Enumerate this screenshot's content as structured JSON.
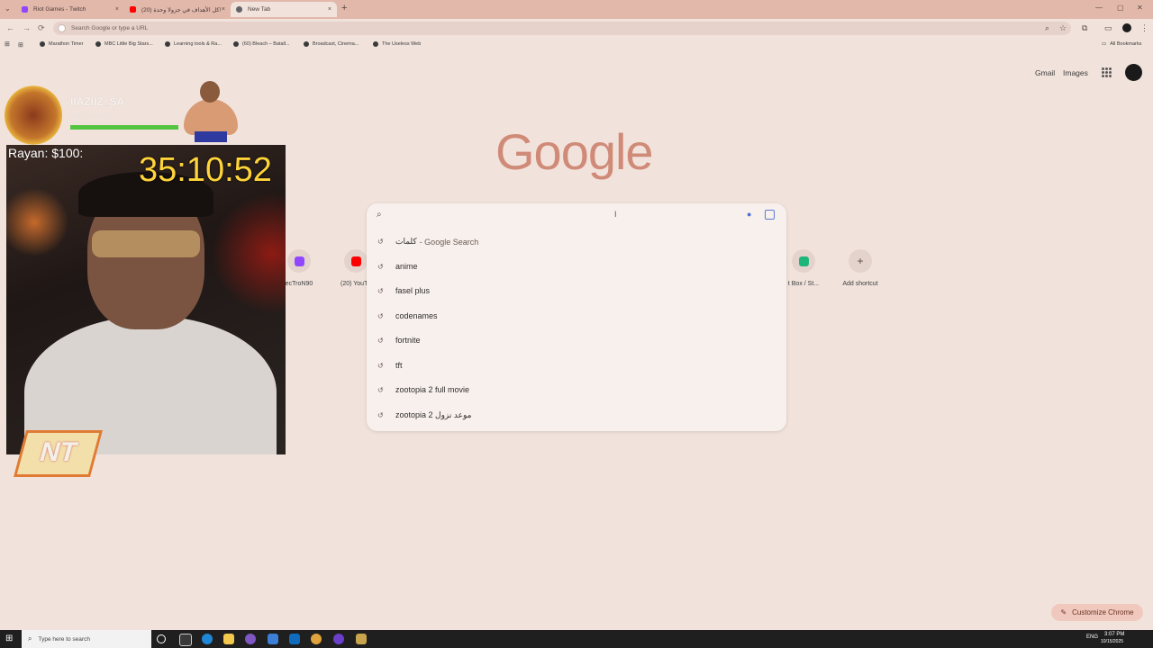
{
  "tabs": [
    {
      "label": "Riot Games - Twitch",
      "close": "×",
      "favicon_color": "#9147ff"
    },
    {
      "label": "(20) كل الأهداف في جزولا وحدة!",
      "close": "×",
      "favicon_color": "#ff0000"
    },
    {
      "label": "New Tab",
      "close": "×",
      "favicon_color": "#5f6368"
    }
  ],
  "tab_menu": "⌄",
  "new_tab": "+",
  "window_controls": {
    "minimize": "—",
    "maximize": "▢",
    "close": "✕"
  },
  "toolbar": {
    "back": "←",
    "forward": "→",
    "reload": "⟳",
    "omnibox_placeholder": "Search Google or type a URL",
    "zoom": "⌕",
    "star": "☆",
    "extensions": "⧉",
    "sidepanel": "▭",
    "menu": "⋮"
  },
  "bookmarks": {
    "apps": "⊞",
    "items": [
      "Marathon Timer",
      "MBC Little Big Stars...",
      "Learning tools & Ra...",
      "(60) Bleach – Batall...",
      "Broadcast, Cinema...",
      "The Useless Web"
    ],
    "all": "All Bookmarks"
  },
  "header": {
    "gmail": "Gmail",
    "images": "Images"
  },
  "logo": "Google",
  "search": {
    "suggestions": [
      {
        "text": "كلمات",
        "suffix": "- Google Search"
      },
      {
        "text": "anime",
        "suffix": ""
      },
      {
        "text": "fasel plus",
        "suffix": ""
      },
      {
        "text": "codenames",
        "suffix": ""
      },
      {
        "text": "fortnite",
        "suffix": ""
      },
      {
        "text": "tft",
        "suffix": ""
      },
      {
        "text": "zootopia 2 full movie",
        "suffix": ""
      },
      {
        "text": "zootopia 2 موعد نزول",
        "suffix": ""
      }
    ],
    "history_icon": "↺"
  },
  "shortcuts": [
    {
      "label": "ecTroN90",
      "color": "#9147ff"
    },
    {
      "label": "(20) YouTu",
      "color": "#ff0000"
    },
    {
      "label": "t Box / St...",
      "color": "#1db57a"
    },
    {
      "label": "Add shortcut",
      "icon": "+"
    }
  ],
  "overlay": {
    "name": "IIAZIIZ_SA",
    "stat": "4800/4800",
    "donation": "Rayan: $100:",
    "timer": "35:10:52",
    "logo": "NT"
  },
  "customize": {
    "label": "Customize Chrome",
    "icon": "✎"
  },
  "taskbar": {
    "start": "⊞",
    "search_placeholder": "Type here to search",
    "search_icon": "⌕",
    "lang": "ENG",
    "time": "3:07 PM",
    "date": "10/15/2025"
  }
}
